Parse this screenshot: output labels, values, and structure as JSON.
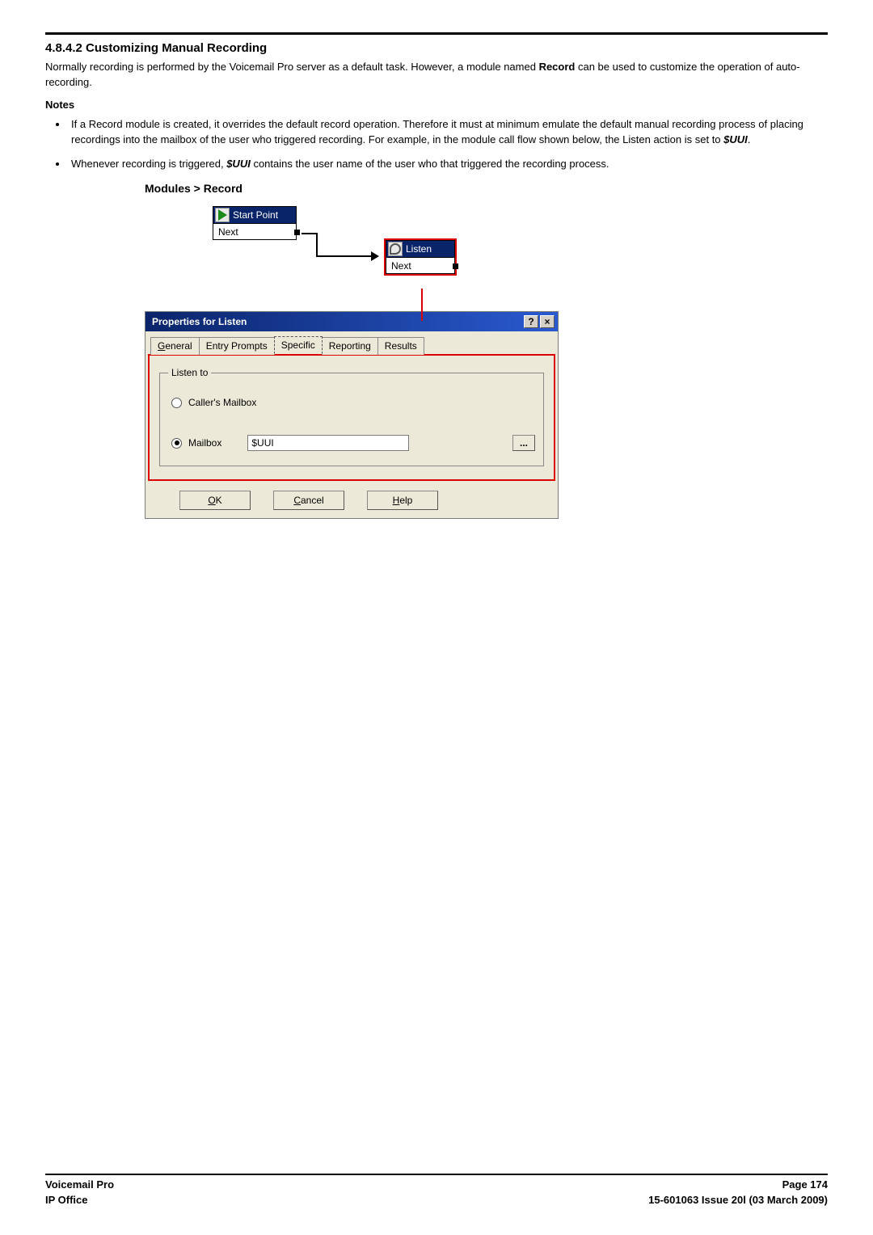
{
  "section": {
    "number": "4.8.4.2",
    "title": "Customizing Manual Recording"
  },
  "paragraph": {
    "pre": "Normally recording is performed by the Voicemail Pro server as a default task. However, a module named ",
    "bold": "Record",
    "post": " can be used to customize the operation of auto-recording."
  },
  "notes_heading": "Notes",
  "notes": [
    {
      "p1a": "If a ",
      "p1b": "Record",
      "p1c": " module is created, it overrides the default record operation. Therefore it must at minimum emulate the default manual recording process of placing recordings into the mailbox of the user who triggered recording. For example, in the module call flow shown below, the Listen action is set to ",
      "p1d": "$UUI",
      "p1e": "."
    },
    {
      "p2a": "Whenever recording is triggered, ",
      "p2b": "$UUI",
      "p2c": " contains the user name of the user who that triggered the recording process."
    }
  ],
  "figure": {
    "breadcrumb": "Modules > Record",
    "start_node": {
      "title": "Start Point",
      "result": "Next"
    },
    "listen_node": {
      "title": "Listen",
      "result": "Next"
    }
  },
  "dialog": {
    "title": "Properties for Listen",
    "help_btn": "?",
    "close_btn": "×",
    "tabs": {
      "general": "General",
      "entry": "Entry Prompts",
      "specific": "Specific",
      "reporting": "Reporting",
      "results": "Results"
    },
    "listen_to_legend": "Listen to",
    "callers_mailbox": "Caller's Mailbox",
    "mailbox": "Mailbox",
    "mailbox_value": "$UUI",
    "browse": "...",
    "ok": "OK",
    "cancel": "Cancel",
    "help": "Help"
  },
  "footer": {
    "left1": "Voicemail Pro",
    "left2": "IP Office",
    "right1": "Page 174",
    "right2": "15-601063 Issue 20l (03 March 2009)"
  }
}
